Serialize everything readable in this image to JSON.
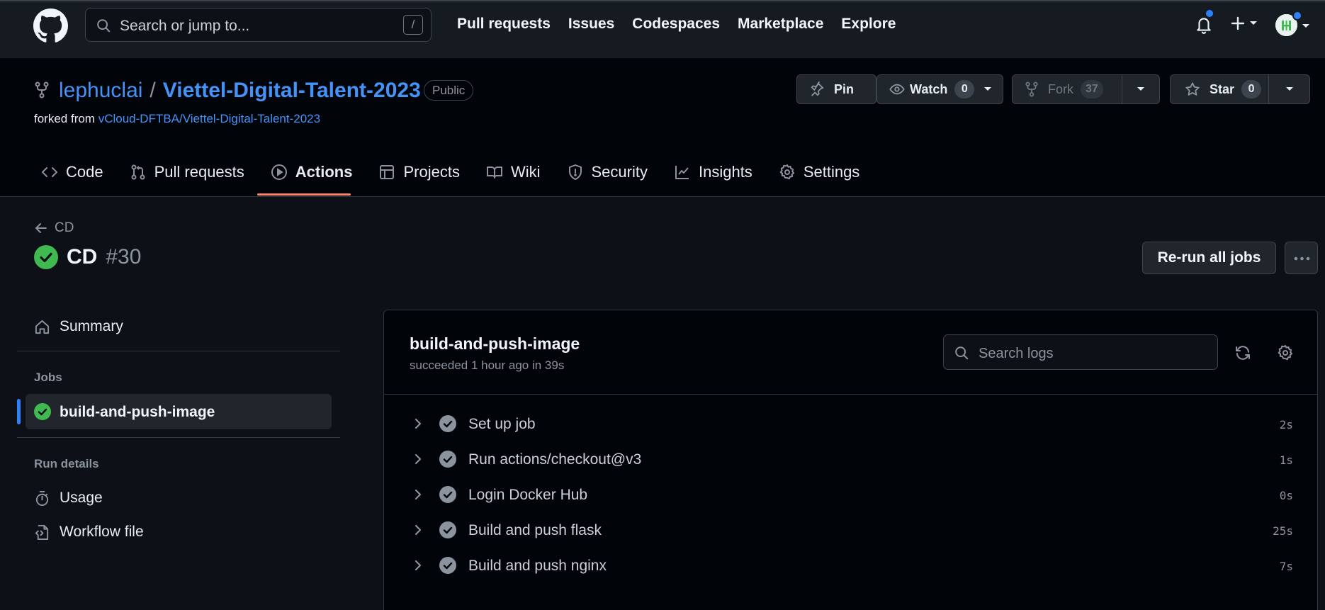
{
  "header": {
    "search_placeholder": "Search or jump to...",
    "search_shortcut": "/",
    "nav": [
      "Pull requests",
      "Issues",
      "Codespaces",
      "Marketplace",
      "Explore"
    ],
    "icons": [
      "github-logo-icon",
      "search-icon",
      "bell-icon",
      "plus-icon",
      "avatar"
    ]
  },
  "repo": {
    "owner": "lephuclai",
    "separator": "/",
    "name": "Viettel-Digital-Talent-2023",
    "visibility": "Public",
    "forked_from_label": "forked from",
    "forked_from": "vCloud-DFTBA/Viettel-Digital-Talent-2023",
    "pin_label": "Pin",
    "watch_label": "Watch",
    "watch_count": "0",
    "fork_label": "Fork",
    "fork_count": "37",
    "star_label": "Star",
    "star_count": "0"
  },
  "tabs": [
    {
      "label": "Code",
      "icon": "code-icon"
    },
    {
      "label": "Pull requests",
      "icon": "pull-request-icon"
    },
    {
      "label": "Actions",
      "icon": "play-icon",
      "active": true
    },
    {
      "label": "Projects",
      "icon": "table-icon"
    },
    {
      "label": "Wiki",
      "icon": "book-icon"
    },
    {
      "label": "Security",
      "icon": "shield-icon"
    },
    {
      "label": "Insights",
      "icon": "graph-icon"
    },
    {
      "label": "Settings",
      "icon": "gear-icon"
    }
  ],
  "run": {
    "back_label": "CD",
    "title": "CD",
    "number": "#30",
    "status": "success",
    "rerun_label": "Re-run all jobs"
  },
  "sidebar": {
    "summary_label": "Summary",
    "jobs_heading": "Jobs",
    "job_label": "build-and-push-image",
    "run_details_heading": "Run details",
    "usage_label": "Usage",
    "workflow_file_label": "Workflow file"
  },
  "job": {
    "title": "build-and-push-image",
    "subtitle": "succeeded 1 hour ago in 39s",
    "search_placeholder": "Search logs",
    "steps": [
      {
        "name": "Set up job",
        "duration": "2s"
      },
      {
        "name": "Run actions/checkout@v3",
        "duration": "1s"
      },
      {
        "name": "Login Docker Hub",
        "duration": "0s"
      },
      {
        "name": "Build and push flask",
        "duration": "25s"
      },
      {
        "name": "Build and push nginx",
        "duration": "7s"
      }
    ]
  },
  "colors": {
    "success": "#3fb950",
    "accent": "#2f81f7",
    "link": "#4493f8",
    "active_tab_underline": "#f78166"
  }
}
